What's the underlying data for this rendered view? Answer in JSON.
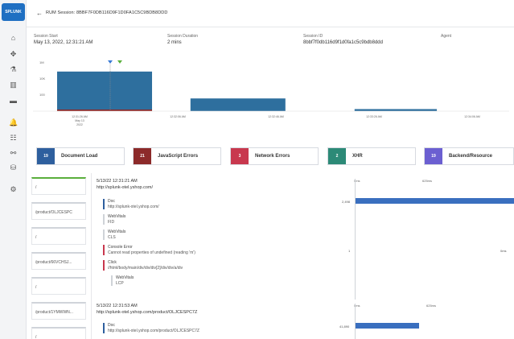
{
  "app": {
    "logo_text": "SPLUNK"
  },
  "rail": {
    "icons": [
      "home-icon",
      "compass-icon",
      "flask-icon",
      "building-icon",
      "car-icon",
      "bell-icon",
      "grid-icon",
      "link-icon",
      "database-icon",
      "gear-icon"
    ]
  },
  "header": {
    "back_glyph": "←",
    "title": "RUM Session: 8BBF7F0DB116D9F1D0FA1C5C9BDB8DDD"
  },
  "info": [
    {
      "label": "Session Start",
      "value": "May 13, 2022, 12:31:21 AM"
    },
    {
      "label": "Session Duration",
      "value": "2 mins"
    },
    {
      "label": "Session ID",
      "value": "8bbf7f0db116d9f1d0fa1c5c9bdb8ddd"
    },
    {
      "label": "Agent",
      "value": ""
    }
  ],
  "chart_data": {
    "type": "bar",
    "ytick_labels": [
      "1M",
      "10K",
      "100"
    ],
    "xtick_labels": [
      "12:31:26 AM\nMay 13\n2022",
      "12:32:06 AM",
      "12:32:46 AM",
      "12:33:26 AM",
      "12:34:06 AM"
    ],
    "bars": [
      {
        "start": 0.0,
        "end": 0.21,
        "level": 0.78
      },
      {
        "start": 0.295,
        "end": 0.505,
        "level": 0.25
      },
      {
        "start": 0.658,
        "end": 0.84,
        "level": 0.04
      }
    ]
  },
  "legend": [
    {
      "count": "19",
      "label": "Document Load",
      "color": "#2e5f9e"
    },
    {
      "count": "21",
      "label": "JavaScript Errors",
      "color": "#8c2a2a"
    },
    {
      "count": "3",
      "label": "Network Errors",
      "color": "#c8384e"
    },
    {
      "count": "2",
      "label": "XHR",
      "color": "#2c8a77"
    },
    {
      "count": "19",
      "label": "Backend/Resource",
      "color": "#6b5fd1"
    }
  ],
  "pages": [
    {
      "label": "/"
    },
    {
      "label": "/product/OLJCESPC"
    },
    {
      "label": "/"
    },
    {
      "label": "/product/66VCHSJ..."
    },
    {
      "label": "/"
    },
    {
      "label": "/product/1YMWWN..."
    },
    {
      "label": "/"
    }
  ],
  "page_blocks": [
    {
      "time": "5/13/22 12:31:21 AM",
      "url": "http://splunk-otel.yshop.com/",
      "events": [
        {
          "title": "Doc",
          "sub": "http://splunk-otel.yshop.com/"
        },
        {
          "title": "WebVitals",
          "sub": "FID"
        },
        {
          "title": "WebVitals",
          "sub": "CLS"
        },
        {
          "title": "Console Error",
          "sub": "Cannot read properties of undefined (reading 'm')"
        },
        {
          "title": "Click",
          "sub": "//html/body/main/div/div/div[2]/div/div/a/div"
        },
        {
          "title": "WebVitals",
          "sub": "LCP"
        }
      ],
      "wf_ticks": [
        "0ms",
        "625ms",
        ""
      ],
      "wf_rows": [
        {
          "label": "2,498",
          "start": 0.0,
          "width": 1.0
        },
        {
          "label": "",
          "start": 0.0,
          "width": 0.0
        },
        {
          "label": "",
          "start": 0.0,
          "width": 0.0
        },
        {
          "label": "1",
          "start": 0.0,
          "width": 0.0
        },
        {
          "label": "0ms",
          "start": 0.0,
          "width": 0.0
        }
      ]
    },
    {
      "time": "5/13/22 12:31:53 AM",
      "url": "http://splunk-otel.yshop.com/product/OLJCESPC7Z",
      "events": [
        {
          "title": "Doc",
          "sub": "http://splunk-otel.yshop.com/product/OLJCESPC7Z"
        }
      ],
      "wf_ticks": [
        "0ms",
        "",
        "625ms"
      ],
      "wf_rows": [
        {
          "label": "41,890",
          "start": 0.0,
          "width": 0.4
        }
      ]
    }
  ]
}
